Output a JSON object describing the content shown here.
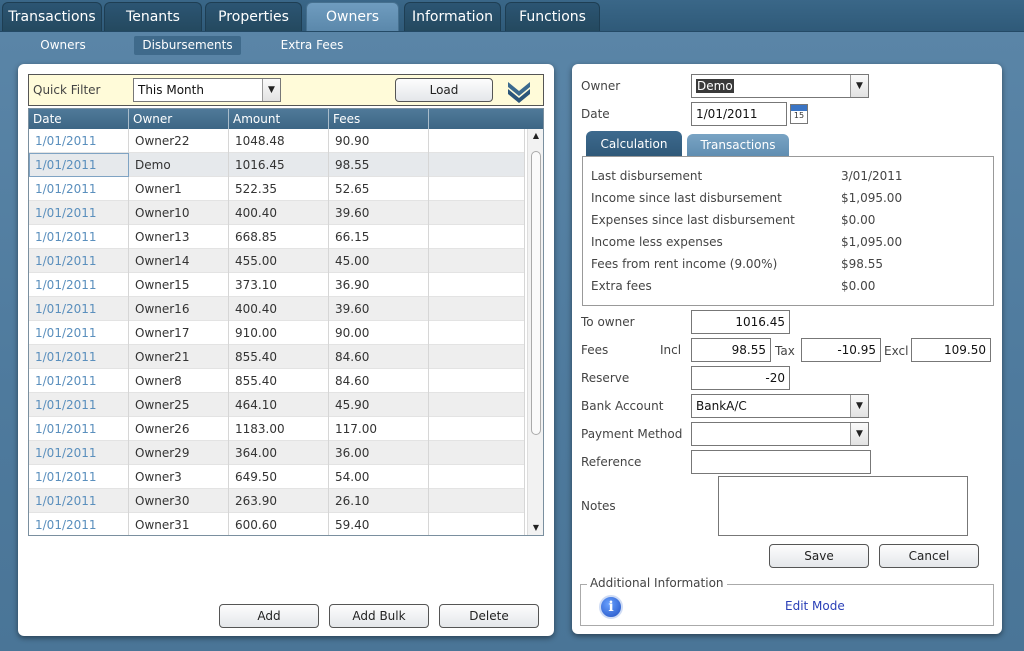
{
  "nav": {
    "tabs": [
      {
        "label": "Transactions",
        "active": false
      },
      {
        "label": "Tenants",
        "active": false
      },
      {
        "label": "Properties",
        "active": false
      },
      {
        "label": "Owners",
        "active": true
      },
      {
        "label": "Information",
        "active": false
      },
      {
        "label": "Functions",
        "active": false
      }
    ],
    "subtabs": [
      {
        "label": "Owners",
        "active": false
      },
      {
        "label": "Disbursements",
        "active": true
      },
      {
        "label": "Extra Fees",
        "active": false
      }
    ]
  },
  "filter": {
    "label": "Quick Filter",
    "value": "This Month",
    "load_label": "Load",
    "expand_icon": "double-chevron-down-icon"
  },
  "grid": {
    "columns": [
      "Date",
      "Owner",
      "Amount",
      "Fees"
    ],
    "rows": [
      [
        "1/01/2011",
        "Owner22",
        "1048.48",
        "90.90"
      ],
      [
        "1/01/2011",
        "Demo",
        "1016.45",
        "98.55"
      ],
      [
        "1/01/2011",
        "Owner1",
        "522.35",
        "52.65"
      ],
      [
        "1/01/2011",
        "Owner10",
        "400.40",
        "39.60"
      ],
      [
        "1/01/2011",
        "Owner13",
        "668.85",
        "66.15"
      ],
      [
        "1/01/2011",
        "Owner14",
        "455.00",
        "45.00"
      ],
      [
        "1/01/2011",
        "Owner15",
        "373.10",
        "36.90"
      ],
      [
        "1/01/2011",
        "Owner16",
        "400.40",
        "39.60"
      ],
      [
        "1/01/2011",
        "Owner17",
        "910.00",
        "90.00"
      ],
      [
        "1/01/2011",
        "Owner21",
        "855.40",
        "84.60"
      ],
      [
        "1/01/2011",
        "Owner8",
        "855.40",
        "84.60"
      ],
      [
        "1/01/2011",
        "Owner25",
        "464.10",
        "45.90"
      ],
      [
        "1/01/2011",
        "Owner26",
        "1183.00",
        "117.00"
      ],
      [
        "1/01/2011",
        "Owner29",
        "364.00",
        "36.00"
      ],
      [
        "1/01/2011",
        "Owner3",
        "649.50",
        "54.00"
      ],
      [
        "1/01/2011",
        "Owner30",
        "263.90",
        "26.10"
      ],
      [
        "1/01/2011",
        "Owner31",
        "600.60",
        "59.40"
      ]
    ],
    "selected_row": 1
  },
  "left_buttons": {
    "add": "Add",
    "add_bulk": "Add Bulk",
    "delete": "Delete"
  },
  "detail": {
    "owner_label": "Owner",
    "owner_value": "Demo",
    "date_label": "Date",
    "date_value": "1/01/2011",
    "calendar_day": "15",
    "tabs": [
      {
        "label": "Calculation",
        "active": true
      },
      {
        "label": "Transactions",
        "active": false
      }
    ],
    "calc_rows": [
      {
        "label": "Last disbursement",
        "value": "3/01/2011"
      },
      {
        "label": "Income since last disbursement",
        "value": "$1,095.00"
      },
      {
        "label": "Expenses since last disbursement",
        "value": "$0.00"
      },
      {
        "label": "Income less expenses",
        "value": "$1,095.00"
      },
      {
        "label": "Fees from rent income (9.00%)",
        "value": "$98.55"
      },
      {
        "label": "Extra fees",
        "value": "$0.00"
      }
    ],
    "to_owner_label": "To owner",
    "to_owner_value": "1016.45",
    "fees_label": "Fees",
    "incl_label": "Incl",
    "incl_value": "98.55",
    "tax_label": "Tax",
    "tax_value": "-10.95",
    "excl_label": "Excl",
    "excl_value": "109.50",
    "reserve_label": "Reserve",
    "reserve_value": "-20",
    "bank_label": "Bank Account",
    "bank_value": "BankA/C",
    "payment_label": "Payment Method",
    "payment_value": "",
    "reference_label": "Reference",
    "reference_value": "",
    "notes_label": "Notes",
    "notes_value": "",
    "save_label": "Save",
    "cancel_label": "Cancel",
    "additional_title": "Additional Information",
    "edit_mode": "Edit Mode"
  }
}
